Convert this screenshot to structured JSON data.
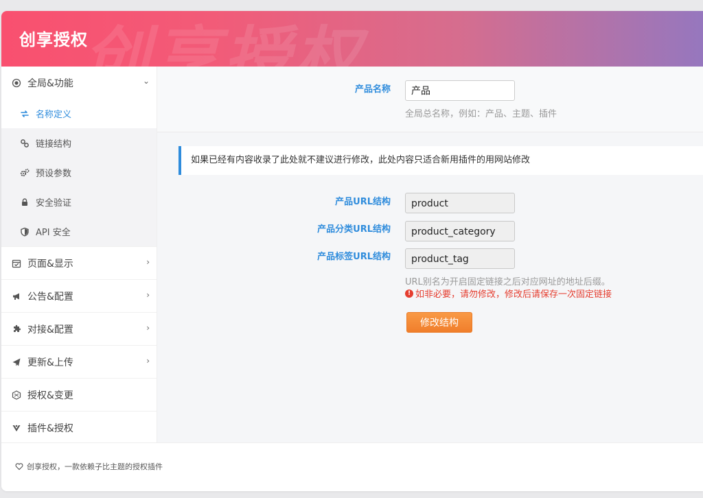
{
  "header": {
    "title": "创享授权",
    "watermark": "创享授权"
  },
  "sidebar": {
    "top": {
      "label": "全局&功能",
      "icon": "radio-circle-icon",
      "chevron": "⌄"
    },
    "sub_items": [
      {
        "label": "名称定义",
        "icon": "sync-arrows-icon",
        "active": true
      },
      {
        "label": "链接结构",
        "icon": "link-icon"
      },
      {
        "label": "预设参数",
        "icon": "gears-icon"
      },
      {
        "label": "安全验证",
        "icon": "lock-icon"
      },
      {
        "label": "API 安全",
        "icon": "shield-icon"
      }
    ],
    "items": [
      {
        "label": "页面&显示",
        "icon": "calendar-check-icon",
        "chevron": "›"
      },
      {
        "label": "公告&配置",
        "icon": "megaphone-icon",
        "chevron": "›"
      },
      {
        "label": "对接&配置",
        "icon": "puzzle-icon",
        "chevron": "›"
      },
      {
        "label": "更新&上传",
        "icon": "paper-plane-icon",
        "chevron": "›"
      },
      {
        "label": "授权&变更",
        "icon": "hexagon-icon"
      },
      {
        "label": "插件&授权",
        "icon": "plugin-icon"
      }
    ]
  },
  "form": {
    "product_name": {
      "label": "产品名称",
      "value": "产品",
      "help": "全局总名称，例如：产品、主题、插件"
    },
    "notice": "如果已经有内容收录了此处就不建议进行修改，此处内容只适合新用插件的用网站修改",
    "url_fields": [
      {
        "label": "产品URL结构",
        "value": "product"
      },
      {
        "label": "产品分类URL结构",
        "value": "product_category"
      },
      {
        "label": "产品标签URL结构",
        "value": "product_tag"
      }
    ],
    "url_help": "URL别名为开启固定链接之后对应网址的地址后缀。",
    "url_warning": "如非必要，请勿修改，修改后请保存一次固定链接",
    "submit_label": "修改结构"
  },
  "footer": {
    "text": "创享授权，一款依赖子比主题的授权插件",
    "icon": "heart-icon"
  },
  "colors": {
    "accent": "#2f8cdc",
    "warning": "#e53d2f",
    "button": "#f07e2b"
  }
}
